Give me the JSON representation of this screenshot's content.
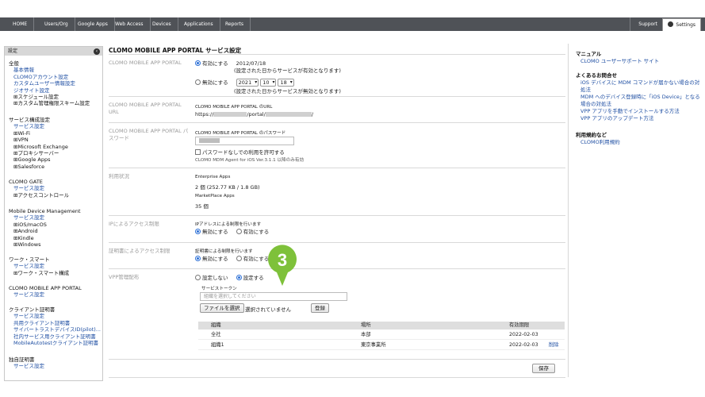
{
  "topnav": {
    "items": [
      "HOME",
      "Users/Org",
      "Google Apps",
      "Web Access",
      "Devices",
      "Applications",
      "Reports"
    ],
    "support": "Support",
    "settings": "Settings"
  },
  "sidebar": {
    "header": "設定",
    "sections": [
      {
        "title": "全般",
        "items": [
          "基本情報",
          "CLOMOアカウント設定",
          "カスタムユーザー情報設定",
          "ジオサイト設定",
          "⊞スケジュール設定",
          "⊞カスタム管理権限スキーム設定"
        ]
      },
      {
        "title": "サービス構成設定",
        "items": [
          "サービス設定",
          "⊞Wi-Fi",
          "⊞VPN",
          "⊞Microsoft Exchange",
          "⊞プロキシサーバー",
          "⊞Google Apps",
          "⊞Salesforce"
        ]
      },
      {
        "title": "CLOMO GATE",
        "items": [
          "サービス設定",
          "⊞アクセスコントロール"
        ]
      },
      {
        "title": "Mobile Device Management",
        "items": [
          "サービス設定",
          "⊞iOS/macOS",
          "⊞Android",
          "⊞Kindle",
          "⊞Windows"
        ]
      },
      {
        "title": "ワーク・スマート",
        "items": [
          "サービス設定",
          "⊞ワーク・スマート構成"
        ]
      },
      {
        "title": "CLOMO MOBILE APP PORTAL",
        "items": [
          "サービス設定"
        ]
      },
      {
        "title": "クライアント証明書",
        "items": [
          "サービス設定",
          "共用クライアント証明書",
          "サイバートラストデバイスID(pilot)...",
          "社内サービス用クライアント証明書",
          "MobileAutotestクライアント証明書"
        ]
      },
      {
        "title": "独自証明書",
        "items": [
          "サービス設定"
        ]
      }
    ]
  },
  "main": {
    "title": "CLOMO MOBILE APP PORTAL サービス設定",
    "portal": {
      "label": "CLOMO MOBILE APP PORTAL",
      "enable_label": "有効にする",
      "enable_date": "2012/07/18",
      "enable_note": "(設定された日からサービスが有効となります)",
      "disable_label": "無効にする",
      "year": "2021",
      "month": "10",
      "day": "18",
      "disable_note": "(設定された日からサービスが無効となります)"
    },
    "url": {
      "label": "CLOMO MOBILE APP PORTAL URL",
      "caption": "CLOMO MOBILE APP PORTAL のURL",
      "prefix": "https://",
      "mid": "/portal/",
      "suffix": "/"
    },
    "password": {
      "label": "CLOMO MOBILE APP PORTAL パスワード",
      "caption": "CLOMO MOBILE APP PORTAL のパスワード",
      "allow_label": "パスワードなしでの利用を許可する",
      "note": "CLOMO MDM Agent for iOS Ver.3.1.1 以降のみ有効"
    },
    "usage": {
      "label": "利用状況",
      "enterprise_title": "Enterprise Apps",
      "enterprise_value": "2 個 (252.77 KB / 1.8 GB)",
      "marketplace_title": "MarketPlace Apps",
      "marketplace_value": "35 個"
    },
    "ip": {
      "label": "IPによるアクセス制限",
      "caption": "IPアドレスによる制限を行います",
      "off_label": "無効にする",
      "on_label": "有効にする"
    },
    "cert": {
      "label": "証明書によるアクセス制限",
      "caption": "証明書による制限を行います",
      "off_label": "無効にする",
      "on_label": "有効にする"
    },
    "vpp": {
      "label": "VPP管理配布",
      "no_label": "設定しない",
      "yes_label": "設定する",
      "token_caption": "サービストークン",
      "org_placeholder": "組織を選択してください",
      "file_button": "ファイルを選択",
      "file_status": "選択されていません",
      "register_button": "登録",
      "headers": [
        "組織",
        "場所",
        "有効期限"
      ],
      "rows": [
        {
          "org": "全社",
          "place": "本部",
          "expiry": "2022-02-03",
          "action": ""
        },
        {
          "org": "組織1",
          "place": "東京事業所",
          "expiry": "2022-02-03",
          "action": "削除"
        }
      ]
    },
    "save_button": "保存",
    "callout_number": "3"
  },
  "right": {
    "sections": [
      {
        "title": "マニュアル",
        "links": [
          "CLOMO ユーザーサポート サイト"
        ]
      },
      {
        "title": "よくあるお問合せ",
        "links": [
          "iOS デバイスに MDM コマンドが届かない場合の対処法",
          "MDM へのデバイス登録時に「iOS Device」となる場合の対処法",
          "VPP アプリを手動でインストールする方法",
          "VPP アプリのアップデート方法"
        ]
      },
      {
        "title": "利用規約など",
        "links": [
          "CLOMO利用規約"
        ]
      }
    ]
  },
  "colors": {
    "nav": "#4f5257",
    "link": "#1f4fa3",
    "callout": "#7ec13a",
    "radio": "#2b6fd6"
  }
}
